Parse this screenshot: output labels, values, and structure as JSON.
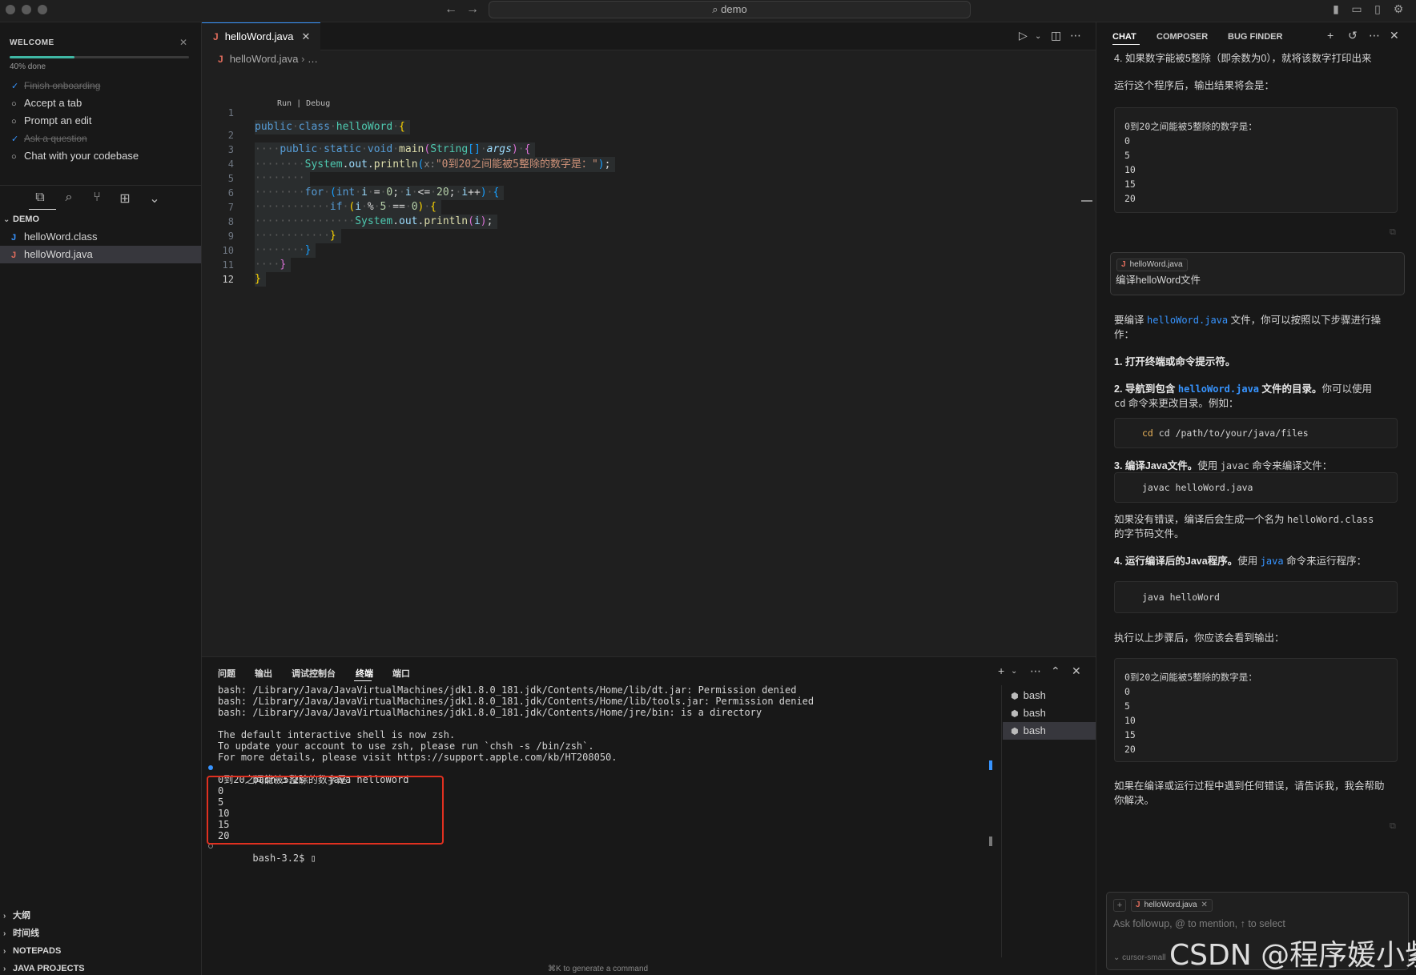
{
  "titlebar": {
    "search": "⌕ demo"
  },
  "welcome": {
    "title": "WELCOME",
    "progress_fraction": 0.36,
    "progress_text": "40% done",
    "tasks": [
      {
        "label": "Finish onboarding",
        "done": true
      },
      {
        "label": "Accept a tab",
        "done": false
      },
      {
        "label": "Prompt an edit",
        "done": false
      },
      {
        "label": "Ask a question",
        "done": true
      },
      {
        "label": "Chat with your codebase",
        "done": false
      }
    ]
  },
  "explorer": {
    "section": "DEMO",
    "files": [
      {
        "name": "helloWord.class",
        "icon": "java-class-icon",
        "color": "#3794ff"
      },
      {
        "name": "helloWord.java",
        "icon": "java-file-icon",
        "color": "#e06c5c"
      }
    ],
    "bottom_sections": [
      "大纲",
      "时间线",
      "NOTEPADS",
      "JAVA PROJECTS"
    ]
  },
  "editor": {
    "tab": "helloWord.java",
    "breadcrumb_file": "helloWord.java",
    "breadcrumb_rest": "…",
    "codelens": "Run | Debug",
    "param_hint": "x:",
    "string_literal": "\"0到20之间能被5整除的数字是：\"",
    "line_numbers": [
      "1",
      "2",
      "3",
      "4",
      "5",
      "6",
      "7",
      "8",
      "9",
      "10",
      "11",
      "12"
    ]
  },
  "panel": {
    "tabs": [
      "问题",
      "输出",
      "调试控制台",
      "终端",
      "端口"
    ],
    "active_tab": "终端",
    "terminal_lines": [
      "bash: /Library/Java/JavaVirtualMachines/jdk1.8.0_181.jdk/Contents/Home/lib/dt.jar: Permission denied",
      "bash: /Library/Java/JavaVirtualMachines/jdk1.8.0_181.jdk/Contents/Home/lib/tools.jar: Permission denied",
      "bash: /Library/Java/JavaVirtualMachines/jdk1.8.0_181.jdk/Contents/Home/jre/bin: is a directory",
      "",
      "The default interactive shell is now zsh.",
      "To update your account to use zsh, please run `chsh -s /bin/zsh`.",
      "For more details, please visit https://support.apple.com/kb/HT208050.",
      "bash-3.2$    java helloWord",
      "0到20之间能被5整除的数字是：",
      "0",
      "5",
      "10",
      "15",
      "20",
      "bash-3.2$ ▯"
    ],
    "shells": [
      "bash",
      "bash",
      "bash"
    ],
    "cmd_hint": "⌘K to generate a command"
  },
  "chat": {
    "tabs": [
      "CHAT",
      "COMPOSER",
      "BUG FINDER"
    ],
    "intro_line": "4. 如果数字能被5整除（即余数为0），就将该数字打印出来",
    "result_intro": "运行这个程序后，输出结果将会是：",
    "output_block": [
      "0到20之间能被5整除的数字是：",
      "0",
      "5",
      "10",
      "15",
      "20"
    ],
    "user_file_pill": "helloWord.java",
    "user_message": "编译helloWord文件",
    "answer_intro_a": "要编译 ",
    "answer_intro_code": "helloWord.java",
    "answer_intro_b": " 文件，你可以按照以下步骤进行操",
    "answer_intro_c": "作：",
    "step1": "1. 打开终端或命令提示符。",
    "step2_a": "2. 导航到包含 ",
    "step2_code": "helloWord.java",
    "step2_b": " 文件的目录。",
    "step2_c": "你可以使用",
    "step2_d_code": "cd",
    "step2_d": " 命令来更改目录。例如：",
    "cmd_cd": "cd /path/to/your/java/files",
    "step3_a": "3. 编译Java文件。",
    "step3_b": "使用 ",
    "step3_code": "javac",
    "step3_c": " 命令来编译文件：",
    "cmd_javac": "javac helloWord.java",
    "after_compile_a": "如果没有错误，编译后会生成一个名为 ",
    "after_compile_code": "helloWord.class",
    "after_compile_b": "的字节码文件。",
    "step4_a": "4. 运行编译后的Java程序。",
    "step4_b": "使用 ",
    "step4_code": "java",
    "step4_c": " 命令来运行程序：",
    "cmd_java": "java helloWord",
    "after_run": "执行以上步骤后，你应该会看到输出：",
    "closing_a": "如果在编译或运行过程中遇到任何错误，请告诉我，我会帮助",
    "closing_b": "你解决。",
    "input_pill": "helloWord.java",
    "input_placeholder": "Ask followup, @ to mention, ↑ to select",
    "model": "⌄ cursor-small"
  },
  "watermark": "CSDN @程序媛小紫"
}
